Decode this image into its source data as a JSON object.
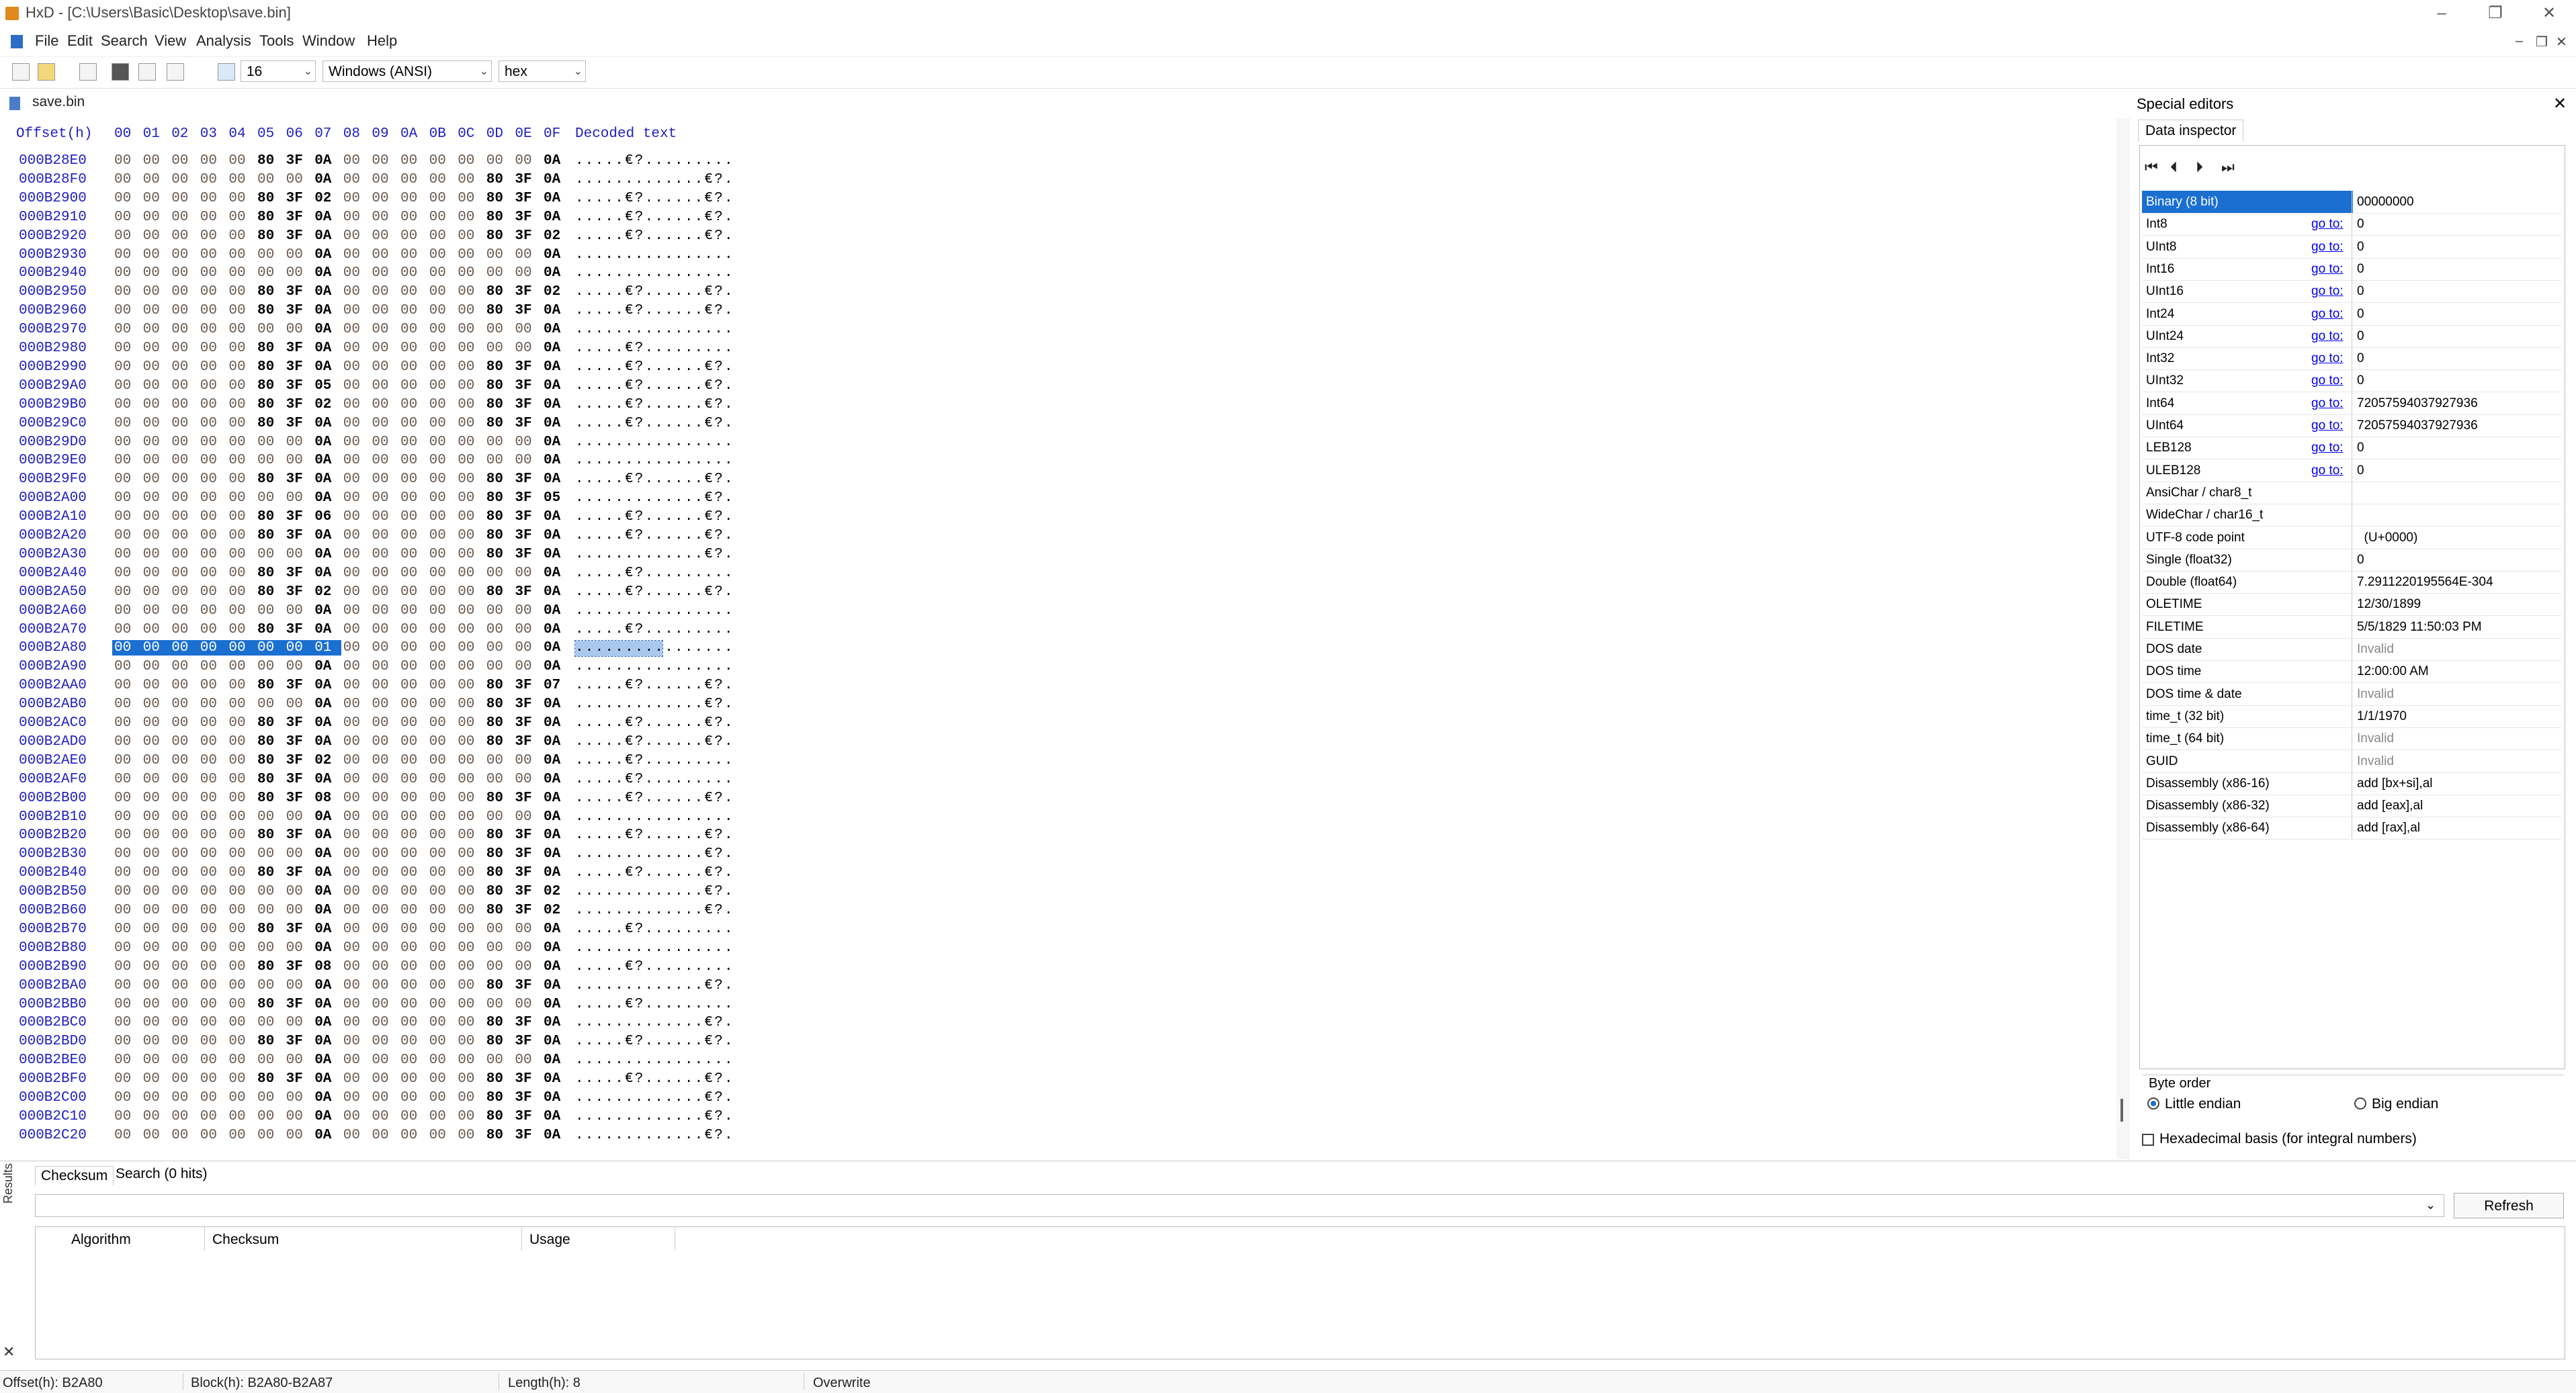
{
  "window": {
    "title": "HxD - [C:\\Users\\Basic\\Desktop\\save.bin]",
    "controls": {
      "minimize": "–",
      "maximize": "❐",
      "close": "✕"
    }
  },
  "menu": [
    "File",
    "Edit",
    "Search",
    "View",
    "Analysis",
    "Tools",
    "Window",
    "Help"
  ],
  "mdi_controls": {
    "minimize": "–",
    "restore": "❐",
    "close": "✕"
  },
  "toolbar": {
    "bytes_per_row": "16",
    "charset": "Windows (ANSI)",
    "offset_base": "hex"
  },
  "document_tab": "save.bin",
  "hex": {
    "header_offset": "Offset(h)",
    "header_columns": [
      "00",
      "01",
      "02",
      "03",
      "04",
      "05",
      "06",
      "07",
      "08",
      "09",
      "0A",
      "0B",
      "0C",
      "0D",
      "0E",
      "0F"
    ],
    "header_text": "Decoded text",
    "rows": [
      {
        "o": "000B28E0",
        "b": "00 00 00 00 00 80 3F 0A 00 00 00 00 00 00 00 0A",
        "t": ".....€?........."
      },
      {
        "o": "000B28F0",
        "b": "00 00 00 00 00 00 00 0A 00 00 00 00 00 80 3F 0A",
        "t": ".............€?."
      },
      {
        "o": "000B2900",
        "b": "00 00 00 00 00 80 3F 02 00 00 00 00 00 80 3F 0A",
        "t": ".....€?......€?."
      },
      {
        "o": "000B2910",
        "b": "00 00 00 00 00 80 3F 0A 00 00 00 00 00 80 3F 0A",
        "t": ".....€?......€?."
      },
      {
        "o": "000B2920",
        "b": "00 00 00 00 00 80 3F 0A 00 00 00 00 00 80 3F 02",
        "t": ".....€?......€?."
      },
      {
        "o": "000B2930",
        "b": "00 00 00 00 00 00 00 0A 00 00 00 00 00 00 00 0A",
        "t": "................"
      },
      {
        "o": "000B2940",
        "b": "00 00 00 00 00 00 00 0A 00 00 00 00 00 00 00 0A",
        "t": "................"
      },
      {
        "o": "000B2950",
        "b": "00 00 00 00 00 80 3F 0A 00 00 00 00 00 80 3F 02",
        "t": ".....€?......€?."
      },
      {
        "o": "000B2960",
        "b": "00 00 00 00 00 80 3F 0A 00 00 00 00 00 80 3F 0A",
        "t": ".....€?......€?."
      },
      {
        "o": "000B2970",
        "b": "00 00 00 00 00 00 00 0A 00 00 00 00 00 00 00 0A",
        "t": "................"
      },
      {
        "o": "000B2980",
        "b": "00 00 00 00 00 80 3F 0A 00 00 00 00 00 00 00 0A",
        "t": ".....€?........."
      },
      {
        "o": "000B2990",
        "b": "00 00 00 00 00 80 3F 0A 00 00 00 00 00 80 3F 0A",
        "t": ".....€?......€?."
      },
      {
        "o": "000B29A0",
        "b": "00 00 00 00 00 80 3F 05 00 00 00 00 00 80 3F 0A",
        "t": ".....€?......€?."
      },
      {
        "o": "000B29B0",
        "b": "00 00 00 00 00 80 3F 02 00 00 00 00 00 80 3F 0A",
        "t": ".....€?......€?."
      },
      {
        "o": "000B29C0",
        "b": "00 00 00 00 00 80 3F 0A 00 00 00 00 00 80 3F 0A",
        "t": ".....€?......€?."
      },
      {
        "o": "000B29D0",
        "b": "00 00 00 00 00 00 00 0A 00 00 00 00 00 00 00 0A",
        "t": "................"
      },
      {
        "o": "000B29E0",
        "b": "00 00 00 00 00 00 00 0A 00 00 00 00 00 00 00 0A",
        "t": "................"
      },
      {
        "o": "000B29F0",
        "b": "00 00 00 00 00 80 3F 0A 00 00 00 00 00 80 3F 0A",
        "t": ".....€?......€?."
      },
      {
        "o": "000B2A00",
        "b": "00 00 00 00 00 00 00 0A 00 00 00 00 00 80 3F 05",
        "t": ".............€?."
      },
      {
        "o": "000B2A10",
        "b": "00 00 00 00 00 80 3F 06 00 00 00 00 00 80 3F 0A",
        "t": ".....€?......€?."
      },
      {
        "o": "000B2A20",
        "b": "00 00 00 00 00 80 3F 0A 00 00 00 00 00 80 3F 0A",
        "t": ".....€?......€?."
      },
      {
        "o": "000B2A30",
        "b": "00 00 00 00 00 00 00 0A 00 00 00 00 00 80 3F 0A",
        "t": ".............€?."
      },
      {
        "o": "000B2A40",
        "b": "00 00 00 00 00 80 3F 0A 00 00 00 00 00 00 00 0A",
        "t": ".....€?........."
      },
      {
        "o": "000B2A50",
        "b": "00 00 00 00 00 80 3F 02 00 00 00 00 00 80 3F 0A",
        "t": ".....€?......€?."
      },
      {
        "o": "000B2A60",
        "b": "00 00 00 00 00 00 00 0A 00 00 00 00 00 00 00 0A",
        "t": "................"
      },
      {
        "o": "000B2A70",
        "b": "00 00 00 00 00 80 3F 0A 00 00 00 00 00 00 00 0A",
        "t": ".....€?........."
      },
      {
        "o": "000B2A80",
        "b": "00 00 00 00 00 00 00 01 00 00 00 00 00 00 00 0A",
        "t": "................",
        "sel": true
      },
      {
        "o": "000B2A90",
        "b": "00 00 00 00 00 00 00 0A 00 00 00 00 00 00 00 0A",
        "t": "................"
      },
      {
        "o": "000B2AA0",
        "b": "00 00 00 00 00 80 3F 0A 00 00 00 00 00 80 3F 07",
        "t": ".....€?......€?."
      },
      {
        "o": "000B2AB0",
        "b": "00 00 00 00 00 00 00 0A 00 00 00 00 00 80 3F 0A",
        "t": ".............€?."
      },
      {
        "o": "000B2AC0",
        "b": "00 00 00 00 00 80 3F 0A 00 00 00 00 00 80 3F 0A",
        "t": ".....€?......€?."
      },
      {
        "o": "000B2AD0",
        "b": "00 00 00 00 00 80 3F 0A 00 00 00 00 00 80 3F 0A",
        "t": ".....€?......€?."
      },
      {
        "o": "000B2AE0",
        "b": "00 00 00 00 00 80 3F 02 00 00 00 00 00 00 00 0A",
        "t": ".....€?........."
      },
      {
        "o": "000B2AF0",
        "b": "00 00 00 00 00 80 3F 0A 00 00 00 00 00 00 00 0A",
        "t": ".....€?........."
      },
      {
        "o": "000B2B00",
        "b": "00 00 00 00 00 80 3F 08 00 00 00 00 00 80 3F 0A",
        "t": ".....€?......€?."
      },
      {
        "o": "000B2B10",
        "b": "00 00 00 00 00 00 00 0A 00 00 00 00 00 00 00 0A",
        "t": "................"
      },
      {
        "o": "000B2B20",
        "b": "00 00 00 00 00 80 3F 0A 00 00 00 00 00 80 3F 0A",
        "t": ".....€?......€?."
      },
      {
        "o": "000B2B30",
        "b": "00 00 00 00 00 00 00 0A 00 00 00 00 00 80 3F 0A",
        "t": ".............€?."
      },
      {
        "o": "000B2B40",
        "b": "00 00 00 00 00 80 3F 0A 00 00 00 00 00 80 3F 0A",
        "t": ".....€?......€?."
      },
      {
        "o": "000B2B50",
        "b": "00 00 00 00 00 00 00 0A 00 00 00 00 00 80 3F 02",
        "t": ".............€?."
      },
      {
        "o": "000B2B60",
        "b": "00 00 00 00 00 00 00 0A 00 00 00 00 00 80 3F 02",
        "t": ".............€?."
      },
      {
        "o": "000B2B70",
        "b": "00 00 00 00 00 80 3F 0A 00 00 00 00 00 00 00 0A",
        "t": ".....€?........."
      },
      {
        "o": "000B2B80",
        "b": "00 00 00 00 00 00 00 0A 00 00 00 00 00 00 00 0A",
        "t": "................"
      },
      {
        "o": "000B2B90",
        "b": "00 00 00 00 00 80 3F 08 00 00 00 00 00 00 00 0A",
        "t": ".....€?........."
      },
      {
        "o": "000B2BA0",
        "b": "00 00 00 00 00 00 00 0A 00 00 00 00 00 80 3F 0A",
        "t": ".............€?."
      },
      {
        "o": "000B2BB0",
        "b": "00 00 00 00 00 80 3F 0A 00 00 00 00 00 00 00 0A",
        "t": ".....€?........."
      },
      {
        "o": "000B2BC0",
        "b": "00 00 00 00 00 00 00 0A 00 00 00 00 00 80 3F 0A",
        "t": ".............€?."
      },
      {
        "o": "000B2BD0",
        "b": "00 00 00 00 00 80 3F 0A 00 00 00 00 00 80 3F 0A",
        "t": ".....€?......€?."
      },
      {
        "o": "000B2BE0",
        "b": "00 00 00 00 00 00 00 0A 00 00 00 00 00 00 00 0A",
        "t": "................"
      },
      {
        "o": "000B2BF0",
        "b": "00 00 00 00 00 80 3F 0A 00 00 00 00 00 80 3F 0A",
        "t": ".....€?......€?."
      },
      {
        "o": "000B2C00",
        "b": "00 00 00 00 00 00 00 0A 00 00 00 00 00 80 3F 0A",
        "t": ".............€?."
      },
      {
        "o": "000B2C10",
        "b": "00 00 00 00 00 00 00 0A 00 00 00 00 00 80 3F 0A",
        "t": ".............€?."
      },
      {
        "o": "000B2C20",
        "b": "00 00 00 00 00 00 00 0A 00 00 00 00 00 80 3F 0A",
        "t": ".............€?."
      }
    ]
  },
  "special_editors": {
    "title": "Special editors",
    "close": "✕",
    "tab": "Data inspector",
    "nav": [
      "⏮",
      "⏴",
      "⏵",
      "⏭"
    ],
    "goto_label": "go to:",
    "rows": [
      {
        "name": "Binary (8 bit)",
        "value": "00000000",
        "goto": false,
        "selected": true
      },
      {
        "name": "Int8",
        "value": "0",
        "goto": true
      },
      {
        "name": "UInt8",
        "value": "0",
        "goto": true
      },
      {
        "name": "Int16",
        "value": "0",
        "goto": true
      },
      {
        "name": "UInt16",
        "value": "0",
        "goto": true
      },
      {
        "name": "Int24",
        "value": "0",
        "goto": true
      },
      {
        "name": "UInt24",
        "value": "0",
        "goto": true
      },
      {
        "name": "Int32",
        "value": "0",
        "goto": true
      },
      {
        "name": "UInt32",
        "value": "0",
        "goto": true
      },
      {
        "name": "Int64",
        "value": "72057594037927936",
        "goto": true
      },
      {
        "name": "UInt64",
        "value": "72057594037927936",
        "goto": true
      },
      {
        "name": "LEB128",
        "value": "0",
        "goto": true
      },
      {
        "name": "ULEB128",
        "value": "0",
        "goto": true
      },
      {
        "name": "AnsiChar / char8_t",
        "value": "",
        "goto": false
      },
      {
        "name": "WideChar / char16_t",
        "value": "",
        "goto": false
      },
      {
        "name": "UTF-8 code point",
        "value": "  (U+0000)",
        "goto": false
      },
      {
        "name": "Single (float32)",
        "value": "0",
        "goto": false
      },
      {
        "name": "Double (float64)",
        "value": "7.2911220195564E-304",
        "goto": false
      },
      {
        "name": "OLETIME",
        "value": "12/30/1899",
        "goto": false
      },
      {
        "name": "FILETIME",
        "value": "5/5/1829 11:50:03 PM",
        "goto": false
      },
      {
        "name": "DOS date",
        "value": "Invalid",
        "goto": false,
        "invalid": true
      },
      {
        "name": "DOS time",
        "value": "12:00:00 AM",
        "goto": false
      },
      {
        "name": "DOS time & date",
        "value": "Invalid",
        "goto": false,
        "invalid": true
      },
      {
        "name": "time_t (32 bit)",
        "value": "1/1/1970",
        "goto": false
      },
      {
        "name": "time_t (64 bit)",
        "value": "Invalid",
        "goto": false,
        "invalid": true
      },
      {
        "name": "GUID",
        "value": "Invalid",
        "goto": false,
        "invalid": true
      },
      {
        "name": "Disassembly (x86-16)",
        "value": "add [bx+si],al",
        "goto": false
      },
      {
        "name": "Disassembly (x86-32)",
        "value": "add [eax],al",
        "goto": false
      },
      {
        "name": "Disassembly (x86-64)",
        "value": "add [rax],al",
        "goto": false
      }
    ],
    "byte_order_label": "Byte order",
    "little_endian": "Little endian",
    "big_endian": "Big endian",
    "hex_basis": "Hexadecimal basis (for integral numbers)"
  },
  "results": {
    "side_label": "Results",
    "close": "✕",
    "tabs": [
      "Checksum",
      "Search (0 hits)"
    ],
    "refresh": "Refresh",
    "columns": [
      "Algorithm",
      "Checksum",
      "Usage"
    ]
  },
  "status": {
    "offset": "Offset(h): B2A80",
    "block": "Block(h): B2A80-B2A87",
    "length": "Length(h): 8",
    "mode": "Overwrite"
  }
}
